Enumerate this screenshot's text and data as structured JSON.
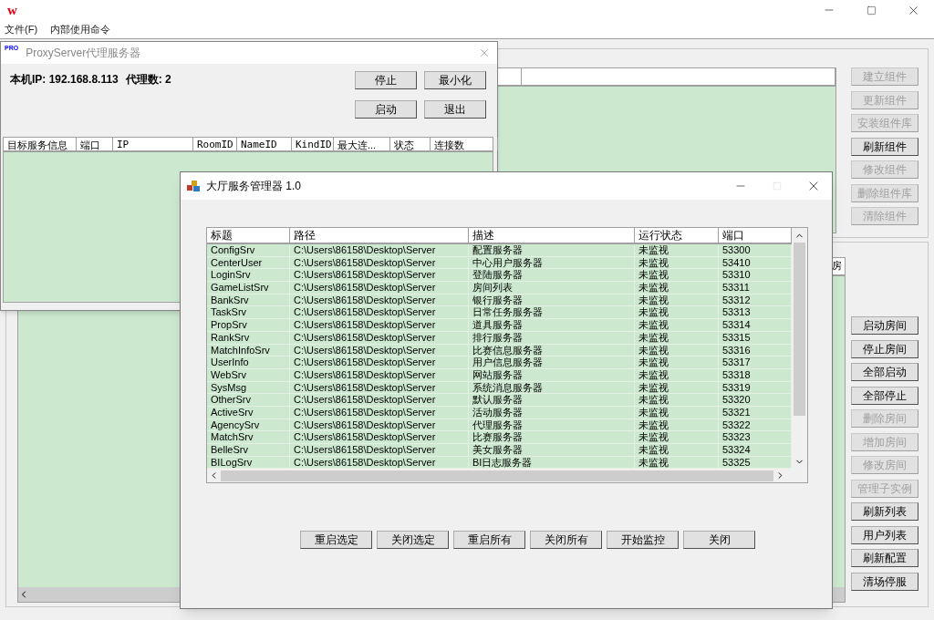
{
  "app": {
    "logo": "w",
    "menu": [
      {
        "label": "文件(F)"
      },
      {
        "label": "内部使用命令"
      }
    ]
  },
  "main": {
    "upper_list_columns": [
      "",
      ""
    ],
    "component_buttons": [
      {
        "label": "建立组件",
        "disabled": true
      },
      {
        "label": "更新组件",
        "disabled": true
      },
      {
        "label": "安装组件库",
        "disabled": true
      },
      {
        "label": "刷新组件",
        "disabled": false
      },
      {
        "label": "修改组件",
        "disabled": true
      },
      {
        "label": "删除组件库",
        "disabled": true
      },
      {
        "label": "清除组件",
        "disabled": true
      }
    ],
    "room_list_columns": [
      "房"
    ],
    "room_buttons": [
      {
        "label": "启动房间",
        "disabled": false
      },
      {
        "label": "停止房间",
        "disabled": false
      },
      {
        "label": "全部启动",
        "disabled": false
      },
      {
        "label": "全部停止",
        "disabled": false
      },
      {
        "label": "删除房间",
        "disabled": true
      },
      {
        "label": "增加房间",
        "disabled": true
      },
      {
        "label": "修改房间",
        "disabled": true
      },
      {
        "label": "管理子实例",
        "disabled": true
      },
      {
        "label": "刷新列表",
        "disabled": false
      },
      {
        "label": "用户列表",
        "disabled": false
      },
      {
        "label": "刷新配置",
        "disabled": false
      },
      {
        "label": "清场停服",
        "disabled": false
      }
    ]
  },
  "proxy_window": {
    "badge": "PRO",
    "title": "ProxyServer代理服务器",
    "ip_label": "本机IP: 192.168.8.113",
    "count_label": "代理数: 2",
    "buttons": [
      {
        "label": "停止"
      },
      {
        "label": "最小化"
      },
      {
        "label": "启动"
      },
      {
        "label": "退出"
      }
    ],
    "columns": [
      "目标服务信息",
      "端口",
      "IP",
      "RoomID",
      "NameID",
      "KindID",
      "最大连...",
      "状态",
      "连接数"
    ]
  },
  "dialog": {
    "title": "大厅服务管理器 1.0",
    "columns": [
      "标题",
      "路径",
      "描述",
      "运行状态",
      "端口"
    ],
    "rows": [
      [
        "ConfigSrv",
        "C:\\Users\\86158\\Desktop\\Server",
        "配置服务器",
        "未监视",
        "53300"
      ],
      [
        "CenterUser",
        "C:\\Users\\86158\\Desktop\\Server",
        "中心用户服务器",
        "未监视",
        "53410"
      ],
      [
        "LoginSrv",
        "C:\\Users\\86158\\Desktop\\Server",
        "登陆服务器",
        "未监视",
        "53310"
      ],
      [
        "GameListSrv",
        "C:\\Users\\86158\\Desktop\\Server",
        "房间列表",
        "未监视",
        "53311"
      ],
      [
        "BankSrv",
        "C:\\Users\\86158\\Desktop\\Server",
        "银行服务器",
        "未监视",
        "53312"
      ],
      [
        "TaskSrv",
        "C:\\Users\\86158\\Desktop\\Server",
        "日常任务服务器",
        "未监视",
        "53313"
      ],
      [
        "PropSrv",
        "C:\\Users\\86158\\Desktop\\Server",
        "道具服务器",
        "未监视",
        "53314"
      ],
      [
        "RankSrv",
        "C:\\Users\\86158\\Desktop\\Server",
        "排行服务器",
        "未监视",
        "53315"
      ],
      [
        "MatchInfoSrv",
        "C:\\Users\\86158\\Desktop\\Server",
        "比赛信息服务器",
        "未监视",
        "53316"
      ],
      [
        "UserInfo",
        "C:\\Users\\86158\\Desktop\\Server",
        "用户信息服务器",
        "未监视",
        "53317"
      ],
      [
        "WebSrv",
        "C:\\Users\\86158\\Desktop\\Server",
        "网站服务器",
        "未监视",
        "53318"
      ],
      [
        "SysMsg",
        "C:\\Users\\86158\\Desktop\\Server",
        "系统消息服务器",
        "未监视",
        "53319"
      ],
      [
        "OtherSrv",
        "C:\\Users\\86158\\Desktop\\Server",
        "默认服务器",
        "未监视",
        "53320"
      ],
      [
        "ActiveSrv",
        "C:\\Users\\86158\\Desktop\\Server",
        "活动服务器",
        "未监视",
        "53321"
      ],
      [
        "AgencySrv",
        "C:\\Users\\86158\\Desktop\\Server",
        "代理服务器",
        "未监视",
        "53322"
      ],
      [
        "MatchSrv",
        "C:\\Users\\86158\\Desktop\\Server",
        "比赛服务器",
        "未监视",
        "53323"
      ],
      [
        "BelleSrv",
        "C:\\Users\\86158\\Desktop\\Server",
        "美女服务器",
        "未监视",
        "53324"
      ],
      [
        "BILogSrv",
        "C:\\Users\\86158\\Desktop\\Server",
        "BI日志服务器",
        "未监视",
        "53325"
      ]
    ],
    "buttons": [
      {
        "label": "重启选定"
      },
      {
        "label": "关闭选定"
      },
      {
        "label": "重启所有"
      },
      {
        "label": "关闭所有"
      },
      {
        "label": "开始监控"
      },
      {
        "label": "关闭"
      }
    ]
  }
}
